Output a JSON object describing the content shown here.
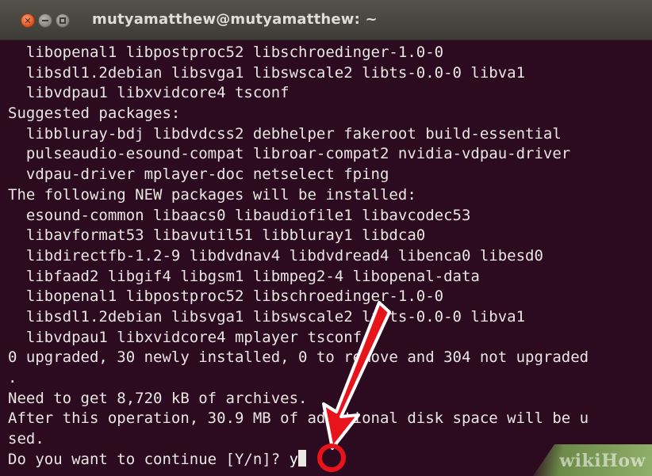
{
  "window": {
    "title": "mutyamatthew@mutyamatthew: ~",
    "close_glyph": "✕",
    "accent": "#e05a23",
    "background": "#2c0b20"
  },
  "terminal": {
    "lines": [
      "  libopenal1 libpostproc52 libschroedinger-1.0-0",
      "  libsdl1.2debian libsvga1 libswscale2 libts-0.0-0 libva1",
      "  libvdpau1 libxvidcore4 tsconf",
      "Suggested packages:",
      "  libbluray-bdj libdvdcss2 debhelper fakeroot build-essential",
      "  pulseaudio-esound-compat libroar-compat2 nvidia-vdpau-driver",
      "  vdpau-driver mplayer-doc netselect fping",
      "The following NEW packages will be installed:",
      "  esound-common libaacs0 libaudiofile1 libavcodec53",
      "  libavformat53 libavutil51 libbluray1 libdca0",
      "  libdirectfb-1.2-9 libdvdnav4 libdvdread4 libenca0 libesd0",
      "  libfaad2 libgif4 libgsm1 libmpeg2-4 libopenal-data",
      "  libopenal1 libpostproc52 libschroedinger-1.0-0",
      "  libsdl1.2debian libsvga1 libswscale2 libts-0.0-0 libva1",
      "  libvdpau1 libxvidcore4 mplayer tsconf",
      "0 upgraded, 30 newly installed, 0 to remove and 304 not upgraded",
      ".",
      "Need to get 8,720 kB of archives.",
      "After this operation, 30.9 MB of additional disk space will be u",
      "sed."
    ],
    "prompt": "Do you want to continue [Y/n]? ",
    "input": "y"
  },
  "overlay": {
    "arrow_color": "#e8141c",
    "arrow_icon": "arrow-down-left-icon",
    "highlight_icon": "circle-highlight-icon"
  },
  "watermark": {
    "text": "wikiHow"
  }
}
